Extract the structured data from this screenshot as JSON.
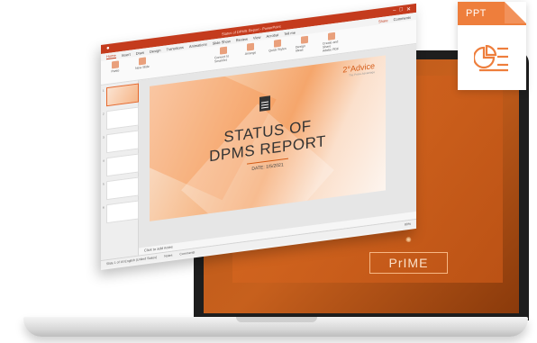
{
  "badge": {
    "label": "PPT",
    "icon": "pie-chart-list-icon",
    "color": "#ee7e3c"
  },
  "window": {
    "title": "Status of DPMS Report - PowerPoint",
    "tabs": [
      "Home",
      "Insert",
      "Draw",
      "Design",
      "Transitions",
      "Animations",
      "Slide Show",
      "Review",
      "View",
      "Acrobat",
      "Tell me"
    ],
    "share": "Share",
    "comments": "Comments",
    "ribbon": [
      "Paste",
      "New Slide",
      "Convert to SmartArt",
      "Arrange",
      "Quick Styles",
      "Design Ideas",
      "Create and Share Adobe PDF"
    ],
    "thumbnail_numbers": [
      "1",
      "2",
      "3",
      "4",
      "5",
      "6"
    ],
    "notes": "Click to add notes",
    "status_left": "Slide 1 of 16   English (United States)",
    "status_notes": "Notes",
    "status_comments": "Comments",
    "zoom": "80%"
  },
  "slide": {
    "logo": "2°Advice",
    "logo_tagline": "The Prime Advantage",
    "title_line1": "STATUS OF",
    "title_line2": "DPMS REPORT",
    "date": "DATE: 1/5/2021"
  },
  "laptop_screen": {
    "text": "PrIME"
  },
  "colors": {
    "accent": "#c43b1d",
    "orange": "#ee7e3c"
  }
}
